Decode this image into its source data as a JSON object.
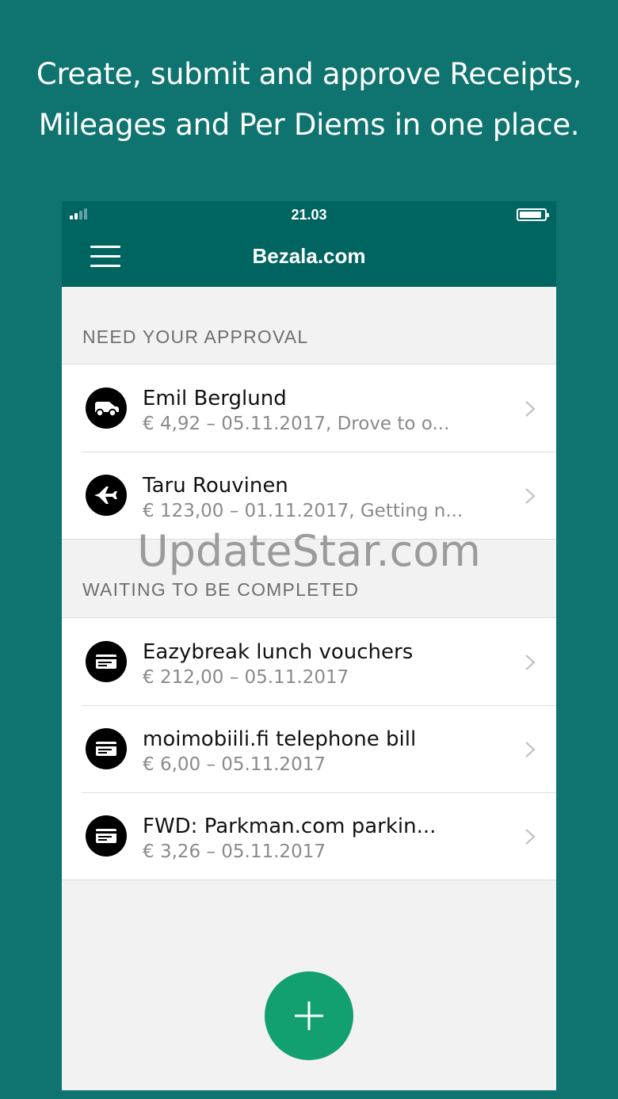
{
  "headline": {
    "line1": "Create, submit and approve Receipts,",
    "line2": "Mileages and Per Diems in one place."
  },
  "status_bar": {
    "time": "21.03"
  },
  "navbar": {
    "title": "Bezala.com",
    "menu_icon": "hamburger-menu-icon"
  },
  "sections": [
    {
      "title": "NEED YOUR APPROVAL",
      "items": [
        {
          "icon": "car-icon",
          "title": "Emil Berglund",
          "subtitle": "€ 4,92 – 05.11.2017, Drove to o..."
        },
        {
          "icon": "airplane-icon",
          "title": "Taru Rouvinen",
          "subtitle": "€ 123,00 – 01.11.2017, Getting n..."
        }
      ]
    },
    {
      "title": "WAITING TO BE COMPLETED",
      "items": [
        {
          "icon": "receipt-icon",
          "title": "Eazybreak lunch vouchers",
          "subtitle": "€ 212,00 – 05.11.2017"
        },
        {
          "icon": "receipt-icon",
          "title": "moimobiili.fi telephone bill",
          "subtitle": "€ 6,00 – 05.11.2017"
        },
        {
          "icon": "receipt-icon",
          "title": "FWD: Parkman.com parkin...",
          "subtitle": "€ 3,26 – 05.11.2017"
        }
      ]
    }
  ],
  "watermark": "UpdateStar.com",
  "colors": {
    "background": "#0f7470",
    "navbar": "#006460",
    "fab": "#12a071"
  }
}
